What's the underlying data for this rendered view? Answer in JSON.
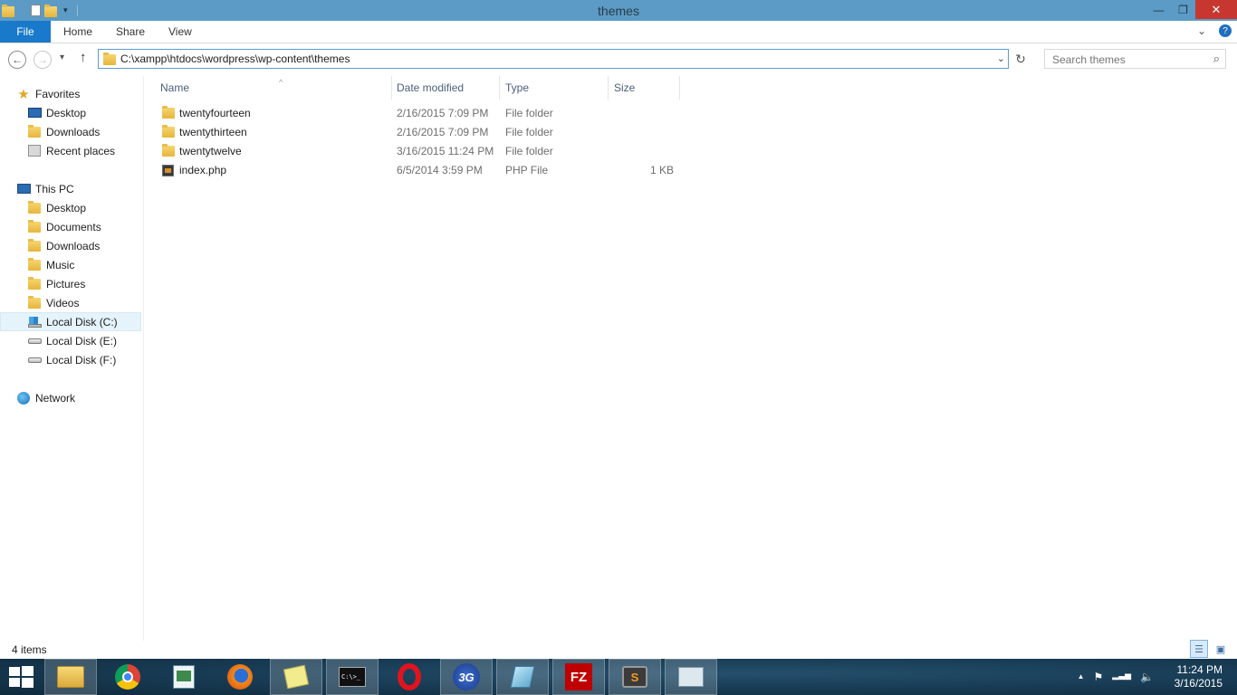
{
  "window": {
    "title": "themes",
    "minimize_glyph": "—",
    "maximize_glyph": "❐",
    "close_glyph": "✕"
  },
  "ribbon": {
    "tabs": [
      {
        "label": "File"
      },
      {
        "label": "Home"
      },
      {
        "label": "Share"
      },
      {
        "label": "View"
      }
    ],
    "expand_glyph": "⌄",
    "help_glyph": "?"
  },
  "navigation": {
    "back_glyph": "←",
    "forward_glyph": "→",
    "recent_glyph": "▾",
    "up_glyph": "↑",
    "address": "C:\\xampp\\htdocs\\wordpress\\wp-content\\themes",
    "address_dropdown_glyph": "⌄",
    "refresh_glyph": "↻",
    "search_placeholder": "Search themes",
    "search_glyph": "⌕"
  },
  "sidebar": {
    "favorites_label": "Favorites",
    "favorites": [
      {
        "label": "Desktop"
      },
      {
        "label": "Downloads"
      },
      {
        "label": "Recent places"
      }
    ],
    "thispc_label": "This PC",
    "thispc": [
      {
        "label": "Desktop"
      },
      {
        "label": "Documents"
      },
      {
        "label": "Downloads"
      },
      {
        "label": "Music"
      },
      {
        "label": "Pictures"
      },
      {
        "label": "Videos"
      },
      {
        "label": "Local Disk (C:)",
        "selected": true
      },
      {
        "label": "Local Disk (E:)"
      },
      {
        "label": "Local Disk (F:)"
      }
    ],
    "network_label": "Network"
  },
  "file_list": {
    "columns": [
      {
        "label": "Name"
      },
      {
        "label": "Date modified"
      },
      {
        "label": "Type"
      },
      {
        "label": "Size"
      }
    ],
    "sort_glyph": "^",
    "rows": [
      {
        "name": "twentyfourteen",
        "date": "2/16/2015 7:09 PM",
        "type": "File folder",
        "size": ""
      },
      {
        "name": "twentythirteen",
        "date": "2/16/2015 7:09 PM",
        "type": "File folder",
        "size": ""
      },
      {
        "name": "twentytwelve",
        "date": "3/16/2015 11:24 PM",
        "type": "File folder",
        "size": ""
      },
      {
        "name": "index.php",
        "date": "6/5/2014 3:59 PM",
        "type": "PHP File",
        "size": "1 KB"
      }
    ]
  },
  "status": {
    "item_count": "4 items"
  },
  "taskbar": {
    "apps": [
      {
        "name": "file-explorer",
        "open": true
      },
      {
        "name": "chrome"
      },
      {
        "name": "notepad"
      },
      {
        "name": "firefox"
      },
      {
        "name": "sticky-notes"
      },
      {
        "name": "command-prompt",
        "label": "C:\\>_"
      },
      {
        "name": "opera"
      },
      {
        "name": "3g-modem",
        "label": "3G"
      },
      {
        "name": "pencil-app"
      },
      {
        "name": "filezilla",
        "label": "FZ"
      },
      {
        "name": "sublime-text",
        "label": "S"
      },
      {
        "name": "resource-monitor"
      }
    ],
    "tray": {
      "up_glyph": "▲",
      "flag_glyph": "⚑",
      "signal_glyph": "▂▃▅",
      "volume_glyph": "🔈"
    },
    "time": "11:24 PM",
    "date": "3/16/2015"
  },
  "colors": {
    "titlebar": "#5b9bc5",
    "file_tab": "#1979ca",
    "close_button": "#c7372f",
    "selection": "#e5f3fb"
  }
}
